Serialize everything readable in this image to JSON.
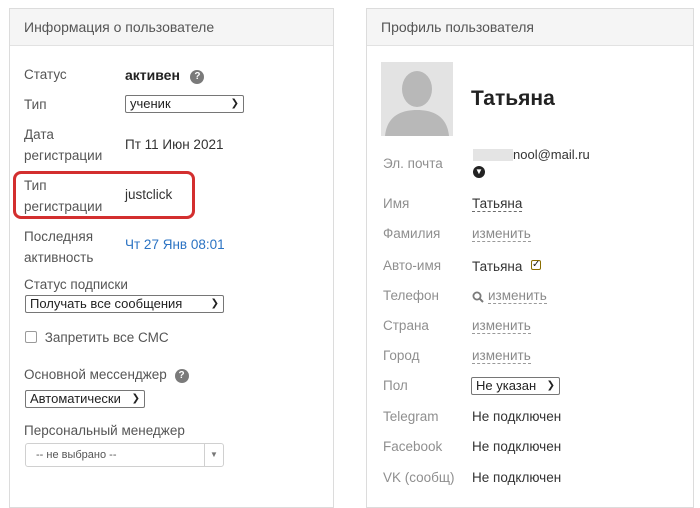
{
  "left": {
    "title": "Информация о пользователе",
    "status_label": "Статус",
    "status_value": "активен",
    "type_label": "Тип",
    "type_value": "ученик",
    "reg_date_label_1": "Дата",
    "reg_date_label_2": "регистрации",
    "reg_date_value": "Пт 11 Июн 2021",
    "reg_type_label_1": "Тип",
    "reg_type_label_2": "регистрации",
    "reg_type_value": "justclick",
    "last_active_label_1": "Последняя",
    "last_active_label_2": "активность",
    "last_active_value": "Чт 27 Янв 08:01",
    "subscription_label": "Статус подписки",
    "subscription_value": "Получать все сообщения",
    "sms_label": "Запретить все СМС",
    "messenger_label": "Основной мессенджер",
    "messenger_value": "Автоматически",
    "manager_label": "Персональный менеджер",
    "manager_value": "-- не выбрано --"
  },
  "right": {
    "title": "Профиль пользователя",
    "name": "Татьяна",
    "email_label": "Эл. почта",
    "email_value": "nool@mail.ru",
    "first_name_label": "Имя",
    "first_name_value": "Татьяна",
    "last_name_label": "Фамилия",
    "last_name_value": "изменить",
    "auto_name_label": "Авто-имя",
    "auto_name_value": "Татьяна",
    "phone_label": "Телефон",
    "phone_value": "изменить",
    "country_label": "Страна",
    "country_value": "изменить",
    "city_label": "Город",
    "city_value": "изменить",
    "gender_label": "Пол",
    "gender_value": "Не указан",
    "telegram_label": "Telegram",
    "telegram_value": "Не подключен",
    "facebook_label": "Facebook",
    "facebook_value": "Не подключен",
    "vk_label": "VK (сообщ)",
    "vk_value": "Не подключен"
  },
  "icons": {
    "help": "question-circle-icon",
    "dropdown": "chevron-down-icon",
    "search": "search-icon",
    "avatar": "user-silhouette-icon",
    "expand": "chevron-circle-icon"
  },
  "colors": {
    "link": "#2b73c3",
    "highlight": "#d32f2f",
    "panel_header_bg": "#f5f5f5"
  }
}
